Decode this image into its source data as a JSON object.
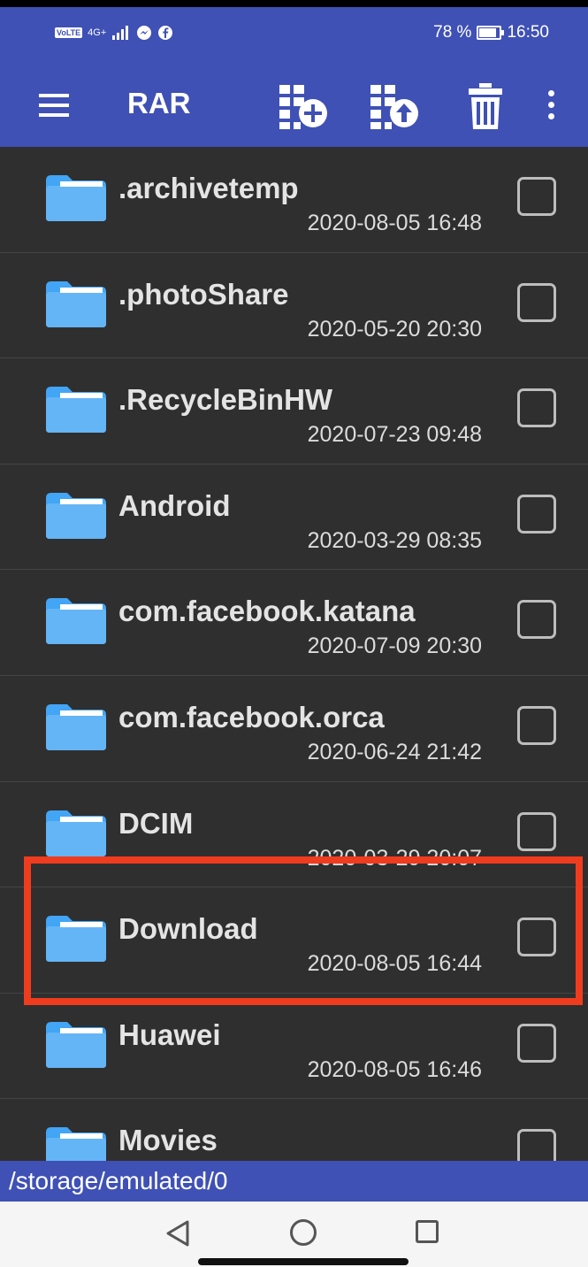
{
  "status_bar": {
    "volte": "VoLTE",
    "network": "4G+",
    "battery_text": "78 %",
    "battery_level": 0.78,
    "time": "16:50",
    "icons": [
      "signal-icon",
      "messenger-icon",
      "facebook-icon",
      "battery-icon"
    ]
  },
  "toolbar": {
    "title": "RAR",
    "icons": [
      "menu-icon",
      "archive-add-icon",
      "archive-extract-icon",
      "trash-icon",
      "more-vert-icon"
    ]
  },
  "files": [
    {
      "name": ".archivetemp",
      "date": "2020-08-05 16:48"
    },
    {
      "name": ".photoShare",
      "date": "2020-05-20 20:30"
    },
    {
      "name": ".RecycleBinHW",
      "date": "2020-07-23 09:48"
    },
    {
      "name": "Android",
      "date": "2020-03-29 08:35"
    },
    {
      "name": "com.facebook.katana",
      "date": "2020-07-09 20:30"
    },
    {
      "name": "com.facebook.orca",
      "date": "2020-06-24 21:42"
    },
    {
      "name": "DCIM",
      "date": "2020-03-29 20:07"
    },
    {
      "name": "Download",
      "date": "2020-08-05 16:44"
    },
    {
      "name": "Huawei",
      "date": "2020-08-05 16:46"
    },
    {
      "name": "Movies",
      "date": ""
    }
  ],
  "highlighted_item": "Download",
  "path": "/storage/emulated/0",
  "colors": {
    "accent": "#3f51b5",
    "background": "#2f2f2f",
    "folder": "#64b5f6",
    "highlight": "#f03c1e"
  }
}
